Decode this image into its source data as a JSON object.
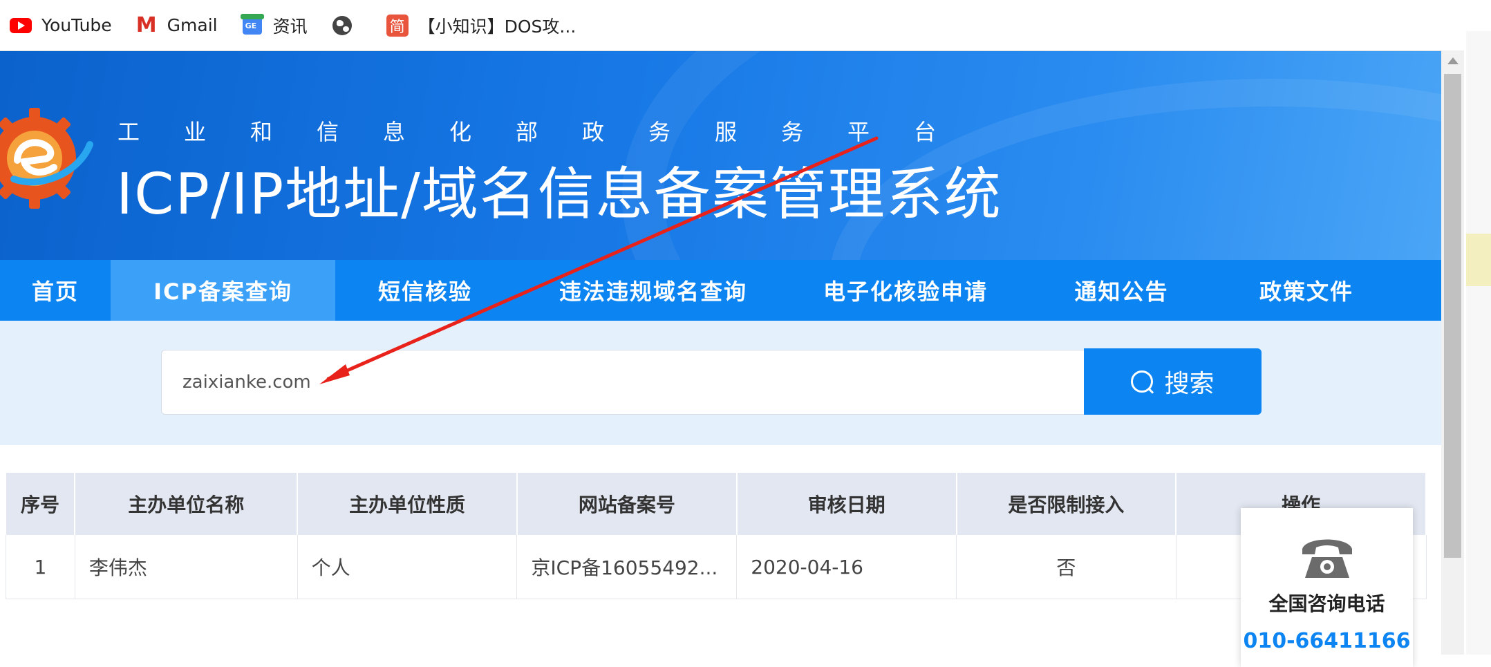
{
  "bookmarks": [
    {
      "label": "YouTube",
      "icon": "youtube-icon"
    },
    {
      "label": "Gmail",
      "icon": "gmail-icon"
    },
    {
      "label": "资讯",
      "icon": "news-icon"
    },
    {
      "label": "",
      "icon": "globe-icon"
    },
    {
      "label": "【小知识】DOS攻...",
      "icon": "jianshu-icon",
      "icon_text": "简"
    }
  ],
  "banner": {
    "subtitle": "工业和信息化部政务服务平台",
    "title": "ICP/IP地址/域名信息备案管理系统"
  },
  "nav": {
    "items": [
      {
        "label": "首页",
        "active": false
      },
      {
        "label": "ICP备案查询",
        "active": true
      },
      {
        "label": "短信核验",
        "active": false
      },
      {
        "label": "违法违规域名查询",
        "active": false
      },
      {
        "label": "电子化核验申请",
        "active": false
      },
      {
        "label": "通知公告",
        "active": false
      },
      {
        "label": "政策文件",
        "active": false
      }
    ]
  },
  "search": {
    "value": "zaixianke.com",
    "button_label": "搜索"
  },
  "table": {
    "headers": [
      "序号",
      "主办单位名称",
      "主办单位性质",
      "网站备案号",
      "审核日期",
      "是否限制接入",
      "操作"
    ],
    "rows": [
      [
        "1",
        "李伟杰",
        "个人",
        "京ICP备16055492...",
        "2020-04-16",
        "否",
        ""
      ]
    ]
  },
  "consult": {
    "title": "全国咨询电话",
    "number": "010-66411166"
  },
  "colors": {
    "accent": "#0c85f2",
    "nav_active": "#3ba0f7",
    "annotation_arrow": "#e8221b"
  }
}
